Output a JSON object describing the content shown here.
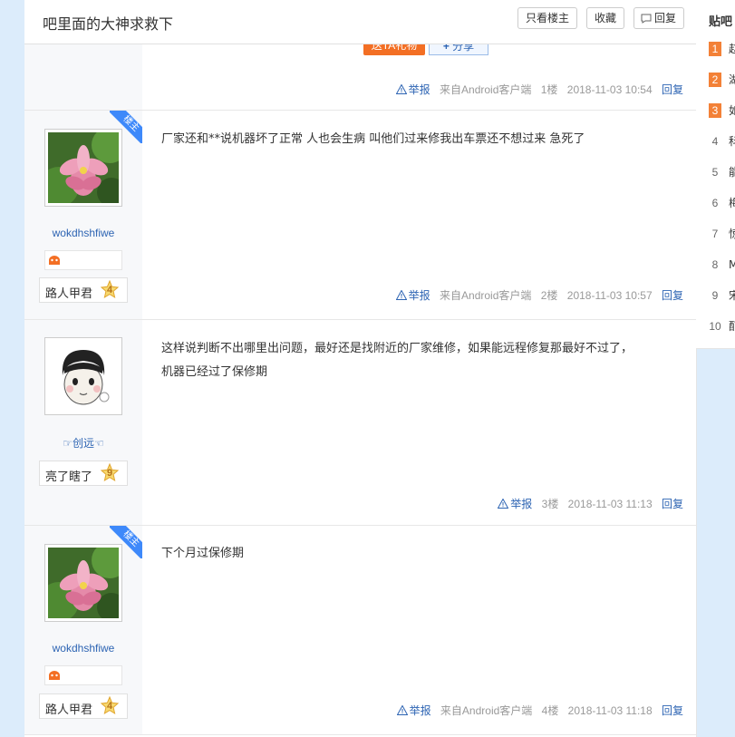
{
  "header": {
    "title": "吧里面的大神求救下",
    "only_op": "只看楼主",
    "favorite": "收藏",
    "reply": "回复"
  },
  "top_post": {
    "gift_label": "送TA礼物",
    "share_label": "分享",
    "report": "举报",
    "source": "来自Android客户端",
    "floor": "1楼",
    "time": "2018-11-03 10:54",
    "reply": "回复"
  },
  "posts": [
    {
      "is_op": true,
      "op_badge": "楼主",
      "username": "wokdhshfiwe",
      "level_name": "路人甲君",
      "level_num": "4",
      "content": "厂家还和**说机器坏了正常 人也会生病 叫他们过来修我出车票还不想过来 急死了",
      "report": "举报",
      "source": "来自Android客户端",
      "floor": "2楼",
      "time": "2018-11-03 10:57",
      "reply": "回复"
    },
    {
      "is_op": false,
      "username": "☞创远☜",
      "level_name": "亮了瞎了",
      "level_num": "9",
      "content_line1": "这样说判断不出哪里出问题，最好还是找附近的厂家维修，如果能远程修复那最好不过了，",
      "content_line2": "机器已经过了保修期",
      "report": "举报",
      "floor": "3楼",
      "time": "2018-11-03 11:13",
      "reply": "回复"
    },
    {
      "is_op": true,
      "op_badge": "楼主",
      "username": "wokdhshfiwe",
      "level_name": "路人甲君",
      "level_num": "4",
      "content": "下个月过保修期",
      "report": "举报",
      "source": "来自Android客户端",
      "floor": "4楼",
      "time": "2018-11-03 11:18",
      "reply": "回复"
    }
  ],
  "sidebar": {
    "title": "贴吧",
    "ranks": [
      {
        "num": "1",
        "text": "赵",
        "hot": true
      },
      {
        "num": "2",
        "text": "湖",
        "hot": true
      },
      {
        "num": "3",
        "text": "如",
        "hot": true
      },
      {
        "num": "4",
        "text": "科",
        "hot": false
      },
      {
        "num": "5",
        "text": "能",
        "hot": false
      },
      {
        "num": "6",
        "text": "梅",
        "hot": false
      },
      {
        "num": "7",
        "text": "惊",
        "hot": false
      },
      {
        "num": "8",
        "text": "M",
        "hot": false
      },
      {
        "num": "9",
        "text": "宋",
        "hot": false
      },
      {
        "num": "10",
        "text": "酊",
        "hot": false
      }
    ]
  },
  "colors": {
    "accent_blue": "#2d64b3",
    "op_ribbon": "#3e89fa",
    "hot_rank": "#f38137",
    "gift_orange": "#f36f24",
    "page_bg": "#dcecfb"
  },
  "icons": [
    "report-icon",
    "share-plus-icon",
    "reply-bubble-icon",
    "level-star-icon",
    "fan-badge-icon",
    "lotus-avatar",
    "cartoon-boy-avatar"
  ]
}
